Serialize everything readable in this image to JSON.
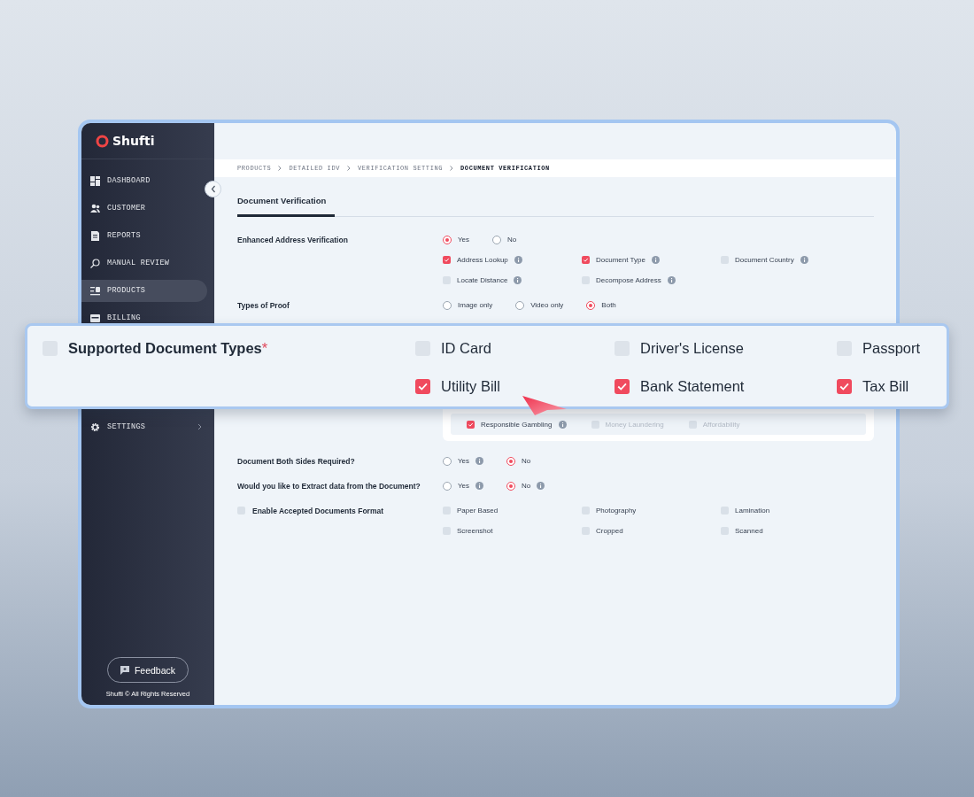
{
  "brand": {
    "name": "Shufti"
  },
  "sidebar": {
    "items": [
      {
        "label": "DASHBOARD",
        "selected": false
      },
      {
        "label": "CUSTOMER",
        "selected": false
      },
      {
        "label": "REPORTS",
        "selected": false
      },
      {
        "label": "MANUAL REVIEW",
        "selected": false
      },
      {
        "label": "PRODUCTS",
        "selected": true
      },
      {
        "label": "BILLING",
        "selected": false
      }
    ],
    "lower_items": [
      {
        "label": "SETTINGS",
        "selected": false,
        "has_submenu": true
      }
    ],
    "feedback_button": {
      "label": "Feedback"
    },
    "footer": "Shufti © All Rights Reserved"
  },
  "breadcrumb": [
    {
      "label": "PRODUCTS",
      "current": false
    },
    {
      "label": "DETAILED IDV",
      "current": false
    },
    {
      "label": "VERIFICATION SETTING",
      "current": false
    },
    {
      "label": "DOCUMENT VERIFICATION",
      "current": true
    }
  ],
  "tabs": [
    {
      "label": "Document Verification",
      "selected": true
    }
  ],
  "form": {
    "rows": [
      {
        "kind": "radio",
        "label": "Enhanced Address Verification",
        "options": [
          {
            "label": "Yes",
            "selected": true,
            "info": false
          },
          {
            "label": "No",
            "selected": false,
            "info": false
          }
        ],
        "checkboxes": [
          {
            "label": "Address Lookup",
            "checked": true,
            "info": true
          },
          {
            "label": "Document Type",
            "checked": true,
            "info": true
          },
          {
            "label": "Document Country",
            "checked": false,
            "info": true
          },
          {
            "label": "Locate Distance",
            "checked": false,
            "info": true
          },
          {
            "label": "Decompose Address",
            "checked": false,
            "info": true
          }
        ]
      },
      {
        "kind": "radio",
        "label": "Types of Proof",
        "options": [
          {
            "label": "Image only",
            "selected": false,
            "info": false
          },
          {
            "label": "Video only",
            "selected": false,
            "info": false
          },
          {
            "label": "Both",
            "selected": true,
            "info": false
          }
        ]
      },
      {
        "kind": "panel",
        "checkboxes": [
          {
            "label": "Responsible Gambling",
            "checked": true,
            "disabled": false,
            "info": true
          },
          {
            "label": "Money Laundering",
            "checked": false,
            "disabled": true,
            "info": false
          },
          {
            "label": "Affordability",
            "checked": false,
            "disabled": true,
            "info": false
          }
        ]
      },
      {
        "kind": "radio",
        "label": "Document Both Sides Required?",
        "options": [
          {
            "label": "Yes",
            "selected": false,
            "info": true
          },
          {
            "label": "No",
            "selected": true,
            "info": false
          }
        ]
      },
      {
        "kind": "radio",
        "label": "Would you like to Extract data from the Document?",
        "options": [
          {
            "label": "Yes",
            "selected": false,
            "info": true
          },
          {
            "label": "No",
            "selected": true,
            "info": true
          }
        ]
      },
      {
        "kind": "toggle_checks",
        "label": "Enable Accepted Documents Format",
        "checked": false,
        "checkboxes": [
          {
            "label": "Paper Based",
            "checked": false,
            "info": false
          },
          {
            "label": "Photography",
            "checked": false,
            "info": false
          },
          {
            "label": "Lamination",
            "checked": false,
            "info": false
          },
          {
            "label": "Screenshot",
            "checked": false,
            "info": false
          },
          {
            "label": "Cropped",
            "checked": false,
            "info": false
          },
          {
            "label": "Scanned",
            "checked": false,
            "info": false
          }
        ]
      }
    ]
  },
  "highlight": {
    "label": "Supported Document Types",
    "required_mark": "*",
    "checked": false,
    "options": [
      {
        "label": "ID Card",
        "checked": false
      },
      {
        "label": "Driver's License",
        "checked": false
      },
      {
        "label": "Passport",
        "checked": false
      },
      {
        "label": "Utility Bill",
        "checked": true
      },
      {
        "label": "Bank Statement",
        "checked": true
      },
      {
        "label": "Tax Bill",
        "checked": true
      }
    ]
  }
}
